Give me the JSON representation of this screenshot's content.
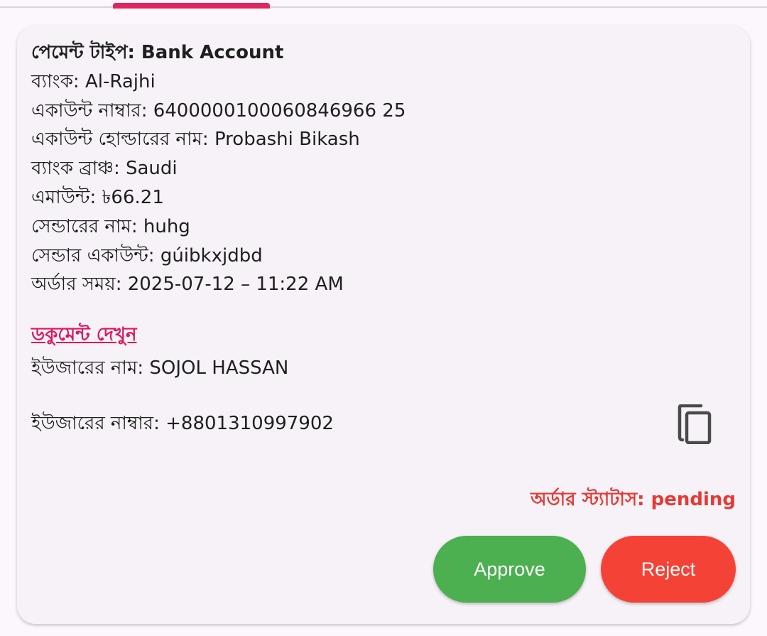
{
  "order": {
    "payment_type": "পেমেন্ট টাইপ: Bank Account",
    "bank": "ব্যাংক: Al-Rajhi",
    "account_number": "একাউন্ট নাম্বার: 6400000100060846966 25",
    "account_holder": "একাউন্ট হোল্ডারের নাম: Probashi Bikash",
    "bank_branch": "ব্যাংক ব্রাঞ্চ: Saudi",
    "amount": "এমাউন্ট: ৳66.21",
    "sender_name": "সেন্ডারের নাম: huhg",
    "sender_account": "সেন্ডার একাউন্ট: gúibkxjdbd",
    "order_time": "অর্ডার সময়: 2025-07-12 – 11:22 AM",
    "document_link": "ডকুমেন্ট দেখুন",
    "user_name": "ইউজারের নাম: SOJOL HASSAN",
    "user_number": "ইউজারের নাম্বার: +8801310997902",
    "status": "অর্ডার স্ট্যাটাস: pending"
  },
  "actions": {
    "approve_label": "Approve",
    "reject_label": "Reject"
  },
  "icons": {
    "copy": "copy-icon"
  },
  "colors": {
    "tab_indicator": "#e0245e",
    "link": "#d81b60",
    "status": "#e53935",
    "approve": "#4caf50",
    "reject": "#f44336"
  }
}
